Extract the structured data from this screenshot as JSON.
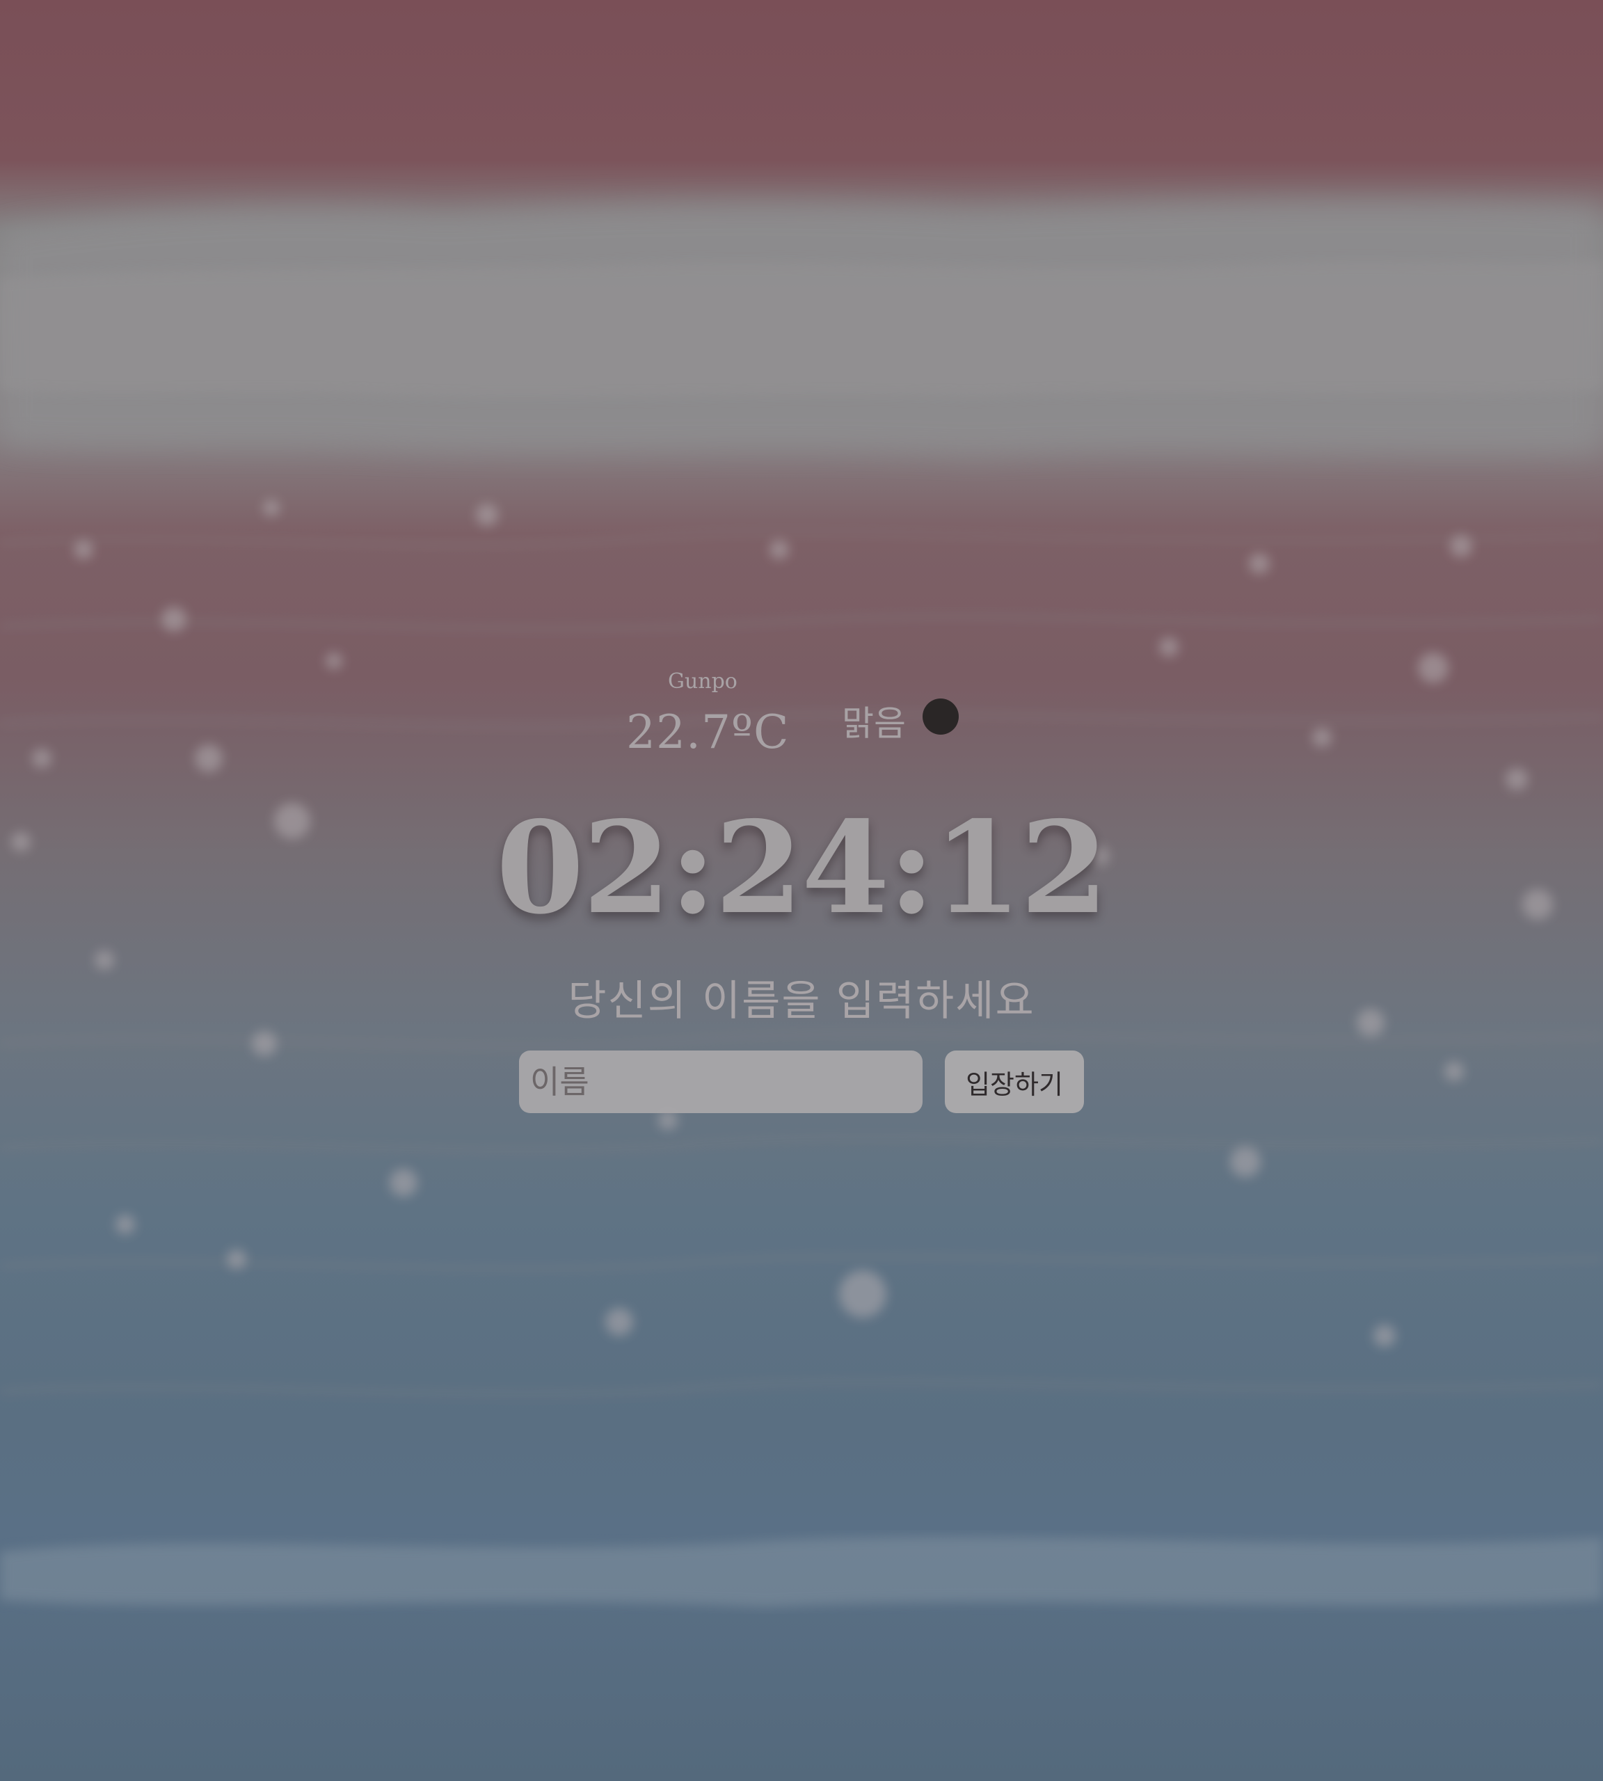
{
  "weather": {
    "city": "Gunpo",
    "temperature": "22.7ºC",
    "description": "맑음",
    "icon": "weather-dot-icon"
  },
  "clock": {
    "time": "02:24:12"
  },
  "login": {
    "prompt": "당신의 이름을 입력하세요",
    "name_placeholder": "이름",
    "enter_label": "입장하기"
  },
  "colors": {
    "top_tint": "#7a4f57",
    "bottom_tint": "#54697c",
    "foam": "#8a8a8c",
    "text": "#a8a2a5"
  }
}
